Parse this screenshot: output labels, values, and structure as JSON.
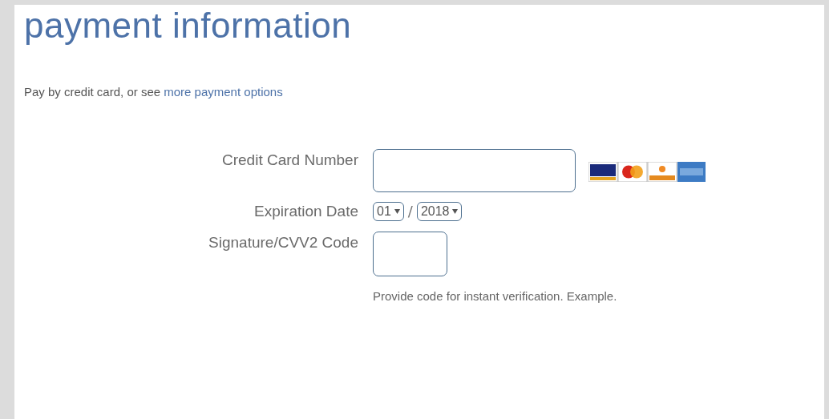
{
  "title": "payment information",
  "intro": {
    "text": "Pay by credit card, or see ",
    "link": "more payment options"
  },
  "fields": [
    {
      "kind": "card",
      "label": "Credit Card Number"
    },
    {
      "kind": "expiry",
      "label": "Expiration Date",
      "month": "01",
      "separator": "/",
      "year": "2018"
    },
    {
      "kind": "cvv",
      "label": "Signature/CVV2 Code",
      "help": "Provide code for instant verification.",
      "help_link": "Example."
    }
  ]
}
